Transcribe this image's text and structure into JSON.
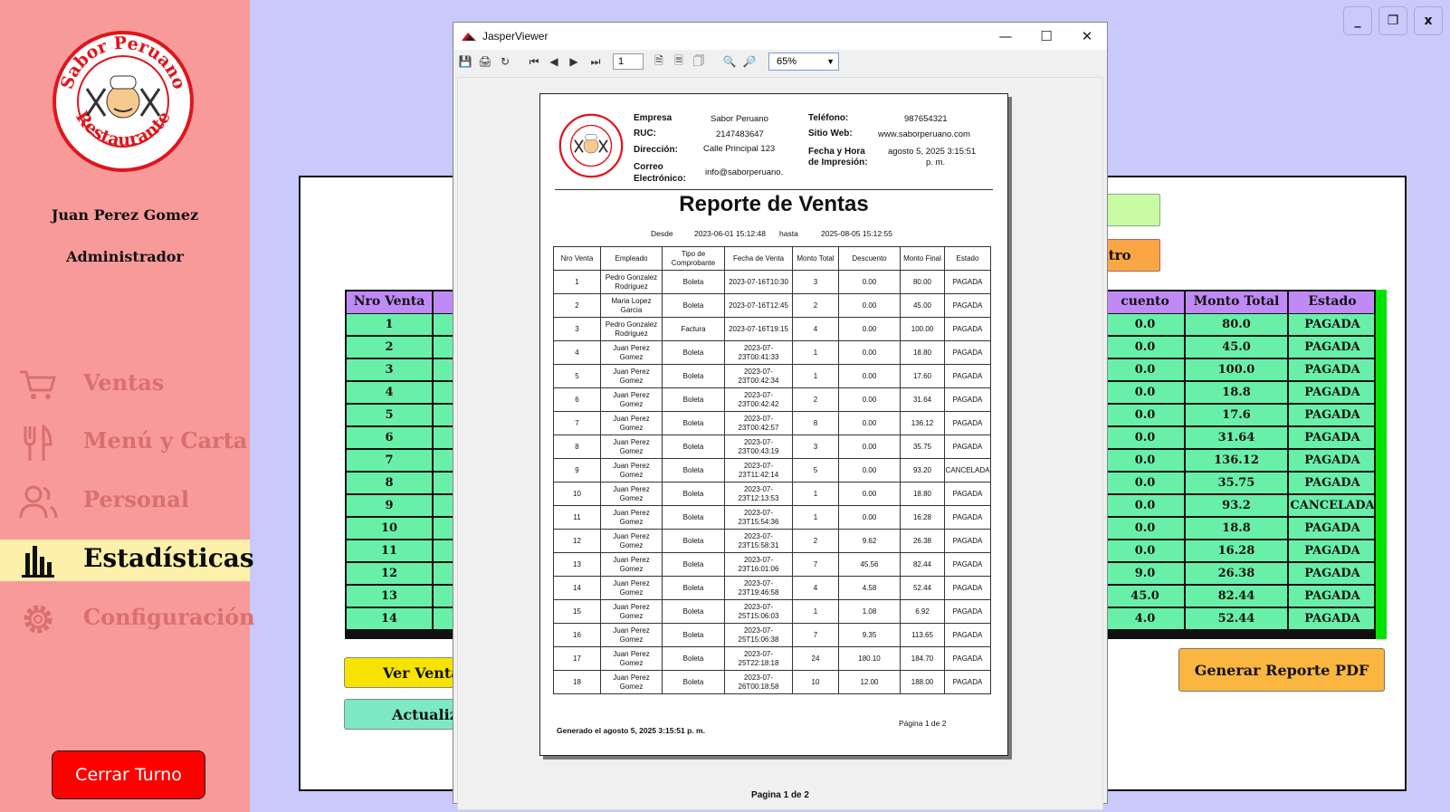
{
  "sidebar": {
    "user_name": "Juan Perez Gomez",
    "user_role": "Administrador",
    "logo_text_top": "Sabor Peruano",
    "logo_text_bottom": "Restaurante",
    "nav": [
      {
        "label": "Ventas",
        "icon": "cart-icon"
      },
      {
        "label": "Menú y Carta",
        "icon": "fork-knife-icon"
      },
      {
        "label": "Personal",
        "icon": "people-icon"
      },
      {
        "label": "Estadísticas",
        "icon": "bar-chart-icon",
        "active": true
      },
      {
        "label": "Configuración",
        "icon": "gear-icon"
      }
    ],
    "logout_label": "Cerrar Turno"
  },
  "window_controls": {
    "minimize": "_",
    "maximize": "❐",
    "close": "x"
  },
  "main": {
    "filter_button_label": "ltro",
    "ver_venta_label": "Ver Venta",
    "actualizar_label": "Actualiz",
    "generate_pdf_label": "Generar Reporte PDF",
    "table_left": {
      "header": "Nro Venta",
      "rows": [
        "1",
        "2",
        "3",
        "4",
        "5",
        "6",
        "7",
        "8",
        "9",
        "10",
        "11",
        "12",
        "13",
        "14"
      ]
    },
    "table_right": {
      "headers": [
        "cuento Total",
        "Monto Total",
        "Estado"
      ],
      "rows": [
        [
          "0.0",
          "80.0",
          "PAGADA"
        ],
        [
          "0.0",
          "45.0",
          "PAGADA"
        ],
        [
          "0.0",
          "100.0",
          "PAGADA"
        ],
        [
          "0.0",
          "18.8",
          "PAGADA"
        ],
        [
          "0.0",
          "17.6",
          "PAGADA"
        ],
        [
          "0.0",
          "31.64",
          "PAGADA"
        ],
        [
          "0.0",
          "136.12",
          "PAGADA"
        ],
        [
          "0.0",
          "35.75",
          "PAGADA"
        ],
        [
          "0.0",
          "93.2",
          "CANCELADA"
        ],
        [
          "0.0",
          "18.8",
          "PAGADA"
        ],
        [
          "0.0",
          "16.28",
          "PAGADA"
        ],
        [
          "9.0",
          "26.38",
          "PAGADA"
        ],
        [
          "45.0",
          "82.44",
          "PAGADA"
        ],
        [
          "4.0",
          "52.44",
          "PAGADA"
        ]
      ]
    }
  },
  "jasper": {
    "title": "JasperViewer",
    "page_number": "1",
    "zoom": "65%",
    "status": "Pagina 1 de 2",
    "report": {
      "empresa_label": "Empresa",
      "empresa": "Sabor Peruano",
      "ruc_label": "RUC:",
      "ruc": "2147483647",
      "direccion_label": "Dirección:",
      "direccion": "Calle Principal 123",
      "correo_label_1": "Correo",
      "correo_label_2": "Electrónico:",
      "correo": "info@saborperuano.",
      "telefono_label": "Teléfono:",
      "telefono": "987654321",
      "web_label": "Sitio Web:",
      "web": "www.saborperuano.com",
      "fecha_label_1": "Fecha y Hora",
      "fecha_label_2": "de Impresión:",
      "fecha_1": "agosto 5, 2025 3:15:51",
      "fecha_2": "p. m.",
      "title": "Reporte de Ventas",
      "desde_label": "Desde",
      "desde": "2023-06-01 15:12:48",
      "hasta_label": "hasta",
      "hasta": "2025-08-05 15:12:55",
      "columns": [
        "Nro Venta",
        "Empleado",
        "Tipo de Comprobante",
        "Fecha de Venta",
        "Monto Total",
        "Descuento",
        "Monto Final",
        "Estado"
      ],
      "rows": [
        [
          "1",
          "Pedro Gonzalez Rodriguez",
          "Boleta",
          "2023-07-16T10:30",
          "3",
          "0.00",
          "80.00",
          "PAGADA"
        ],
        [
          "2",
          "Maria Lopez Garcia",
          "Boleta",
          "2023-07-16T12:45",
          "2",
          "0.00",
          "45.00",
          "PAGADA"
        ],
        [
          "3",
          "Pedro Gonzalez Rodriguez",
          "Factura",
          "2023-07-16T19:15",
          "4",
          "0.00",
          "100.00",
          "PAGADA"
        ],
        [
          "4",
          "Juan Perez Gomez",
          "Boleta",
          "2023-07-23T00:41:33",
          "1",
          "0.00",
          "18.80",
          "PAGADA"
        ],
        [
          "5",
          "Juan Perez Gomez",
          "Boleta",
          "2023-07-23T00:42:34",
          "1",
          "0.00",
          "17.60",
          "PAGADA"
        ],
        [
          "6",
          "Juan Perez Gomez",
          "Boleta",
          "2023-07-23T00:42:42",
          "2",
          "0.00",
          "31.64",
          "PAGADA"
        ],
        [
          "7",
          "Juan Perez Gomez",
          "Boleta",
          "2023-07-23T00:42:57",
          "8",
          "0.00",
          "136.12",
          "PAGADA"
        ],
        [
          "8",
          "Juan Perez Gomez",
          "Boleta",
          "2023-07-23T00:43:19",
          "3",
          "0.00",
          "35.75",
          "PAGADA"
        ],
        [
          "9",
          "Juan Perez Gomez",
          "Boleta",
          "2023-07-23T11:42:14",
          "5",
          "0.00",
          "93.20",
          "CANCELADA"
        ],
        [
          "10",
          "Juan Perez Gomez",
          "Boleta",
          "2023-07-23T12:13:53",
          "1",
          "0.00",
          "18.80",
          "PAGADA"
        ],
        [
          "11",
          "Juan Perez Gomez",
          "Boleta",
          "2023-07-23T15:54:36",
          "1",
          "0.00",
          "16.28",
          "PAGADA"
        ],
        [
          "12",
          "Juan Perez Gomez",
          "Boleta",
          "2023-07-23T15:58:31",
          "2",
          "9.62",
          "26.38",
          "PAGADA"
        ],
        [
          "13",
          "Juan Perez Gomez",
          "Boleta",
          "2023-07-23T16:01:06",
          "7",
          "45.56",
          "82.44",
          "PAGADA"
        ],
        [
          "14",
          "Juan Perez Gomez",
          "Boleta",
          "2023-07-23T19:46:58",
          "4",
          "4.58",
          "52.44",
          "PAGADA"
        ],
        [
          "15",
          "Juan Perez Gomez",
          "Boleta",
          "2023-07-25T15:06:03",
          "1",
          "1.08",
          "6.92",
          "PAGADA"
        ],
        [
          "16",
          "Juan Perez Gomez",
          "Boleta",
          "2023-07-25T15:06:38",
          "7",
          "9.35",
          "113.65",
          "PAGADA"
        ],
        [
          "17",
          "Juan Perez Gomez",
          "Boleta",
          "2023-07-25T22:18:18",
          "24",
          "180.10",
          "184.70",
          "PAGADA"
        ],
        [
          "18",
          "Juan Perez Gomez",
          "Boleta",
          "2023-07-26T00:18:58",
          "10",
          "12.00",
          "188.00",
          "PAGADA"
        ]
      ],
      "page_footer": "Página 1 de 2",
      "generated": "Generado el  agosto 5, 2025 3:15:51 p. m."
    }
  }
}
